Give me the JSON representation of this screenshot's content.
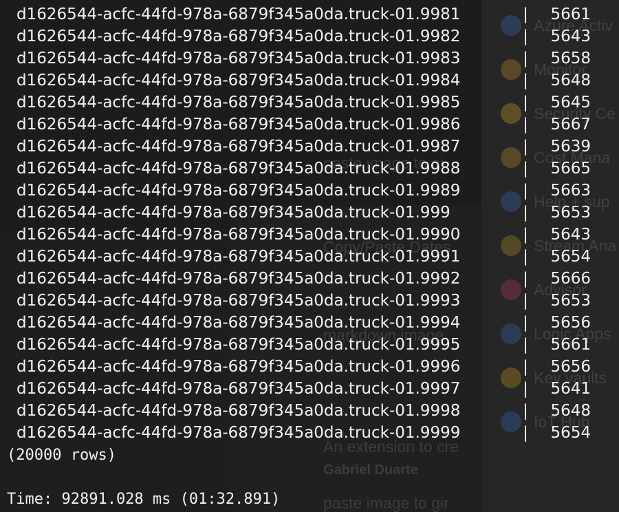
{
  "rows": [
    {
      "key": "d1626544-acfc-44fd-978a-6879f345a0da.truck-01.9981",
      "value": "5661"
    },
    {
      "key": "d1626544-acfc-44fd-978a-6879f345a0da.truck-01.9982",
      "value": "5643"
    },
    {
      "key": "d1626544-acfc-44fd-978a-6879f345a0da.truck-01.9983",
      "value": "5658"
    },
    {
      "key": "d1626544-acfc-44fd-978a-6879f345a0da.truck-01.9984",
      "value": "5648"
    },
    {
      "key": "d1626544-acfc-44fd-978a-6879f345a0da.truck-01.9985",
      "value": "5645"
    },
    {
      "key": "d1626544-acfc-44fd-978a-6879f345a0da.truck-01.9986",
      "value": "5667"
    },
    {
      "key": "d1626544-acfc-44fd-978a-6879f345a0da.truck-01.9987",
      "value": "5639"
    },
    {
      "key": "d1626544-acfc-44fd-978a-6879f345a0da.truck-01.9988",
      "value": "5665"
    },
    {
      "key": "d1626544-acfc-44fd-978a-6879f345a0da.truck-01.9989",
      "value": "5663"
    },
    {
      "key": "d1626544-acfc-44fd-978a-6879f345a0da.truck-01.999",
      "value": "5653"
    },
    {
      "key": "d1626544-acfc-44fd-978a-6879f345a0da.truck-01.9990",
      "value": "5643"
    },
    {
      "key": "d1626544-acfc-44fd-978a-6879f345a0da.truck-01.9991",
      "value": "5654"
    },
    {
      "key": "d1626544-acfc-44fd-978a-6879f345a0da.truck-01.9992",
      "value": "5666"
    },
    {
      "key": "d1626544-acfc-44fd-978a-6879f345a0da.truck-01.9993",
      "value": "5653"
    },
    {
      "key": "d1626544-acfc-44fd-978a-6879f345a0da.truck-01.9994",
      "value": "5656"
    },
    {
      "key": "d1626544-acfc-44fd-978a-6879f345a0da.truck-01.9995",
      "value": "5661"
    },
    {
      "key": "d1626544-acfc-44fd-978a-6879f345a0da.truck-01.9996",
      "value": "5656"
    },
    {
      "key": "d1626544-acfc-44fd-978a-6879f345a0da.truck-01.9997",
      "value": "5641"
    },
    {
      "key": "d1626544-acfc-44fd-978a-6879f345a0da.truck-01.9998",
      "value": "5648"
    },
    {
      "key": "d1626544-acfc-44fd-978a-6879f345a0da.truck-01.9999",
      "value": "5654"
    }
  ],
  "separator": "|",
  "row_count": "(20000 rows)",
  "timing": "Time: 92891.028 ms (01:32.891)",
  "background": {
    "items": [
      "Azure Activ",
      "Monitor",
      "Security Ce",
      "Cost Mana",
      "Help + sup",
      "Stream Ana",
      "Advisor",
      "Logic Apps",
      "Key vaults",
      "IoT Hub"
    ],
    "lines": [
      "paste image to gi",
      "Copy/Paste Dates",
      "markdown image",
      "An extension to cre",
      "Gabriel Duarte",
      "paste image to gir"
    ]
  },
  "colors": {
    "terminal_bg": "#1c1c1c",
    "text": "#f2f2f2"
  }
}
